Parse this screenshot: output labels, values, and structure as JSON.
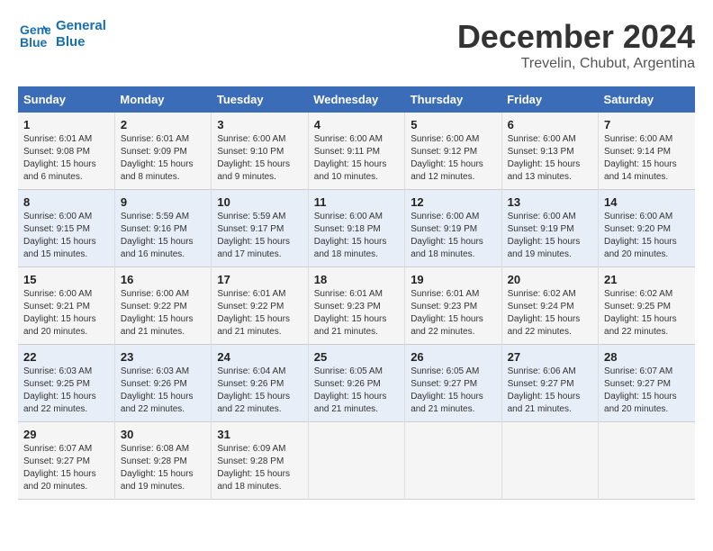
{
  "header": {
    "logo_line1": "General",
    "logo_line2": "Blue",
    "month": "December 2024",
    "location": "Trevelin, Chubut, Argentina"
  },
  "weekdays": [
    "Sunday",
    "Monday",
    "Tuesday",
    "Wednesday",
    "Thursday",
    "Friday",
    "Saturday"
  ],
  "weeks": [
    [
      {
        "day": "1",
        "info": "Sunrise: 6:01 AM\nSunset: 9:08 PM\nDaylight: 15 hours\nand 6 minutes."
      },
      {
        "day": "2",
        "info": "Sunrise: 6:01 AM\nSunset: 9:09 PM\nDaylight: 15 hours\nand 8 minutes."
      },
      {
        "day": "3",
        "info": "Sunrise: 6:00 AM\nSunset: 9:10 PM\nDaylight: 15 hours\nand 9 minutes."
      },
      {
        "day": "4",
        "info": "Sunrise: 6:00 AM\nSunset: 9:11 PM\nDaylight: 15 hours\nand 10 minutes."
      },
      {
        "day": "5",
        "info": "Sunrise: 6:00 AM\nSunset: 9:12 PM\nDaylight: 15 hours\nand 12 minutes."
      },
      {
        "day": "6",
        "info": "Sunrise: 6:00 AM\nSunset: 9:13 PM\nDaylight: 15 hours\nand 13 minutes."
      },
      {
        "day": "7",
        "info": "Sunrise: 6:00 AM\nSunset: 9:14 PM\nDaylight: 15 hours\nand 14 minutes."
      }
    ],
    [
      {
        "day": "8",
        "info": "Sunrise: 6:00 AM\nSunset: 9:15 PM\nDaylight: 15 hours\nand 15 minutes."
      },
      {
        "day": "9",
        "info": "Sunrise: 5:59 AM\nSunset: 9:16 PM\nDaylight: 15 hours\nand 16 minutes."
      },
      {
        "day": "10",
        "info": "Sunrise: 5:59 AM\nSunset: 9:17 PM\nDaylight: 15 hours\nand 17 minutes."
      },
      {
        "day": "11",
        "info": "Sunrise: 6:00 AM\nSunset: 9:18 PM\nDaylight: 15 hours\nand 18 minutes."
      },
      {
        "day": "12",
        "info": "Sunrise: 6:00 AM\nSunset: 9:19 PM\nDaylight: 15 hours\nand 18 minutes."
      },
      {
        "day": "13",
        "info": "Sunrise: 6:00 AM\nSunset: 9:19 PM\nDaylight: 15 hours\nand 19 minutes."
      },
      {
        "day": "14",
        "info": "Sunrise: 6:00 AM\nSunset: 9:20 PM\nDaylight: 15 hours\nand 20 minutes."
      }
    ],
    [
      {
        "day": "15",
        "info": "Sunrise: 6:00 AM\nSunset: 9:21 PM\nDaylight: 15 hours\nand 20 minutes."
      },
      {
        "day": "16",
        "info": "Sunrise: 6:00 AM\nSunset: 9:22 PM\nDaylight: 15 hours\nand 21 minutes."
      },
      {
        "day": "17",
        "info": "Sunrise: 6:01 AM\nSunset: 9:22 PM\nDaylight: 15 hours\nand 21 minutes."
      },
      {
        "day": "18",
        "info": "Sunrise: 6:01 AM\nSunset: 9:23 PM\nDaylight: 15 hours\nand 21 minutes."
      },
      {
        "day": "19",
        "info": "Sunrise: 6:01 AM\nSunset: 9:23 PM\nDaylight: 15 hours\nand 22 minutes."
      },
      {
        "day": "20",
        "info": "Sunrise: 6:02 AM\nSunset: 9:24 PM\nDaylight: 15 hours\nand 22 minutes."
      },
      {
        "day": "21",
        "info": "Sunrise: 6:02 AM\nSunset: 9:25 PM\nDaylight: 15 hours\nand 22 minutes."
      }
    ],
    [
      {
        "day": "22",
        "info": "Sunrise: 6:03 AM\nSunset: 9:25 PM\nDaylight: 15 hours\nand 22 minutes."
      },
      {
        "day": "23",
        "info": "Sunrise: 6:03 AM\nSunset: 9:26 PM\nDaylight: 15 hours\nand 22 minutes."
      },
      {
        "day": "24",
        "info": "Sunrise: 6:04 AM\nSunset: 9:26 PM\nDaylight: 15 hours\nand 22 minutes."
      },
      {
        "day": "25",
        "info": "Sunrise: 6:05 AM\nSunset: 9:26 PM\nDaylight: 15 hours\nand 21 minutes."
      },
      {
        "day": "26",
        "info": "Sunrise: 6:05 AM\nSunset: 9:27 PM\nDaylight: 15 hours\nand 21 minutes."
      },
      {
        "day": "27",
        "info": "Sunrise: 6:06 AM\nSunset: 9:27 PM\nDaylight: 15 hours\nand 21 minutes."
      },
      {
        "day": "28",
        "info": "Sunrise: 6:07 AM\nSunset: 9:27 PM\nDaylight: 15 hours\nand 20 minutes."
      }
    ],
    [
      {
        "day": "29",
        "info": "Sunrise: 6:07 AM\nSunset: 9:27 PM\nDaylight: 15 hours\nand 20 minutes."
      },
      {
        "day": "30",
        "info": "Sunrise: 6:08 AM\nSunset: 9:28 PM\nDaylight: 15 hours\nand 19 minutes."
      },
      {
        "day": "31",
        "info": "Sunrise: 6:09 AM\nSunset: 9:28 PM\nDaylight: 15 hours\nand 18 minutes."
      },
      null,
      null,
      null,
      null
    ]
  ]
}
